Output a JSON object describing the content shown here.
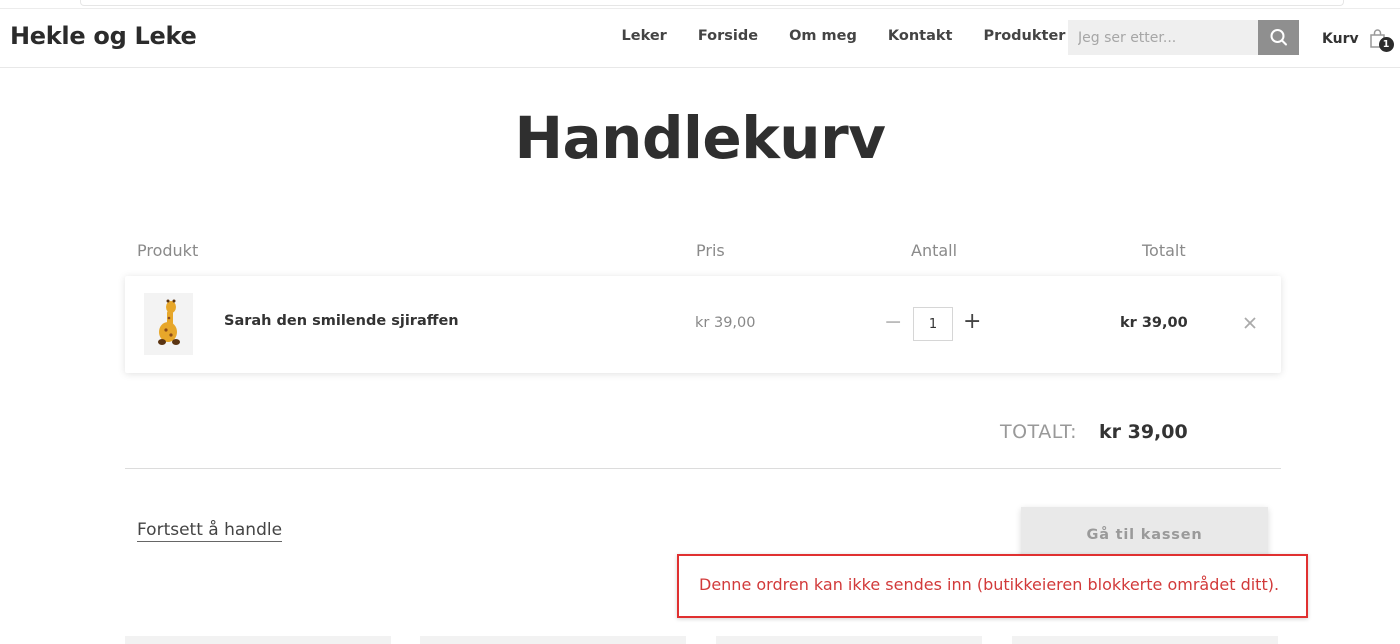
{
  "header": {
    "logo": "Hekle og Leke",
    "nav": [
      "Leker",
      "Forside",
      "Om meg",
      "Kontakt",
      "Produkter"
    ],
    "search_placeholder": "Jeg ser etter...",
    "cart_label": "Kurv",
    "cart_count": "1"
  },
  "page_title": "Handlekurv",
  "table": {
    "headers": [
      "Produkt",
      "Pris",
      "Antall",
      "Totalt"
    ],
    "items": [
      {
        "name": "Sarah den smilende sjiraffen",
        "price": "kr 39,00",
        "quantity": "1",
        "total": "kr 39,00"
      }
    ]
  },
  "summary": {
    "label": "TOTALT:",
    "value": "kr 39,00"
  },
  "actions": {
    "continue_label": "Fortsett å handle",
    "checkout_label": "Gå til kassen"
  },
  "error_message": "Denne ordren kan ikke sendes inn (butikkeieren blokkerte området ditt).",
  "icons": {
    "search": "search-icon",
    "cart": "shopping-bag-icon",
    "remove": "close-icon",
    "product": "giraffe-toy-image"
  },
  "colors": {
    "error": "#d23a3a",
    "error_border": "#e03030",
    "button_bg": "#e9e9e9",
    "search_button": "#8f8f8f"
  }
}
